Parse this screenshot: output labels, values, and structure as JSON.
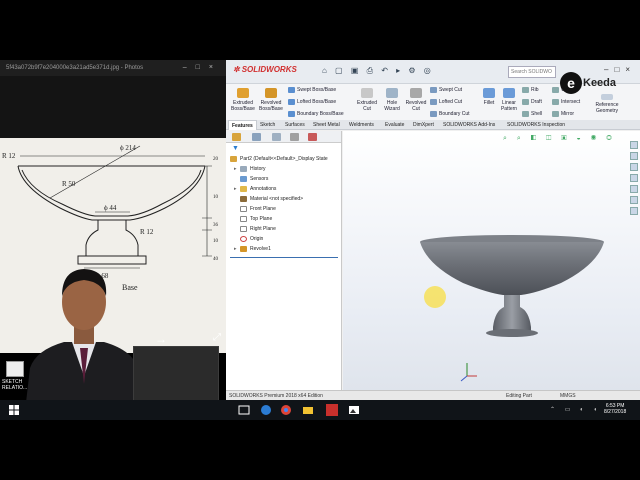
{
  "photos": {
    "title": "5f43a072b9f7e204000e3a21ad5e371d.jpg - Photos",
    "drawing_labels": {
      "dia_top": "ϕ 214",
      "r_left": "R 12",
      "r50": "R 50",
      "dia_stem": "ϕ 44",
      "r12_stem": "R 12",
      "base_dia": "ϕ 68",
      "base_label": "Base",
      "v_label_1": "20",
      "v_label_2": "10",
      "v_label_3": "36",
      "v_label_4": "10",
      "v_label_5": "40"
    }
  },
  "solidworks": {
    "brand": "SOLIDWORKS",
    "search_placeholder": "Search SOLIDWO",
    "ribbon": {
      "extruded_boss": "Extruded Boss/Base",
      "revolved_boss": "Revolved Boss/Base",
      "swept_boss": "Swept Boss/Base",
      "lofted_boss": "Lofted Boss/Base",
      "boundary_boss": "Boundary Boss/Base",
      "extruded_cut": "Extruded Cut",
      "hole_wizard": "Hole Wizard",
      "revolved_cut": "Revolved Cut",
      "swept_cut": "Swept Cut",
      "lofted_cut": "Lofted Cut",
      "boundary_cut": "Boundary Cut",
      "fillet": "Fillet",
      "linear_pattern": "Linear Pattern",
      "rib": "Rib",
      "draft": "Draft",
      "shell": "Shell",
      "wrap": "Wrap",
      "intersect": "Intersect",
      "mirror": "Mirror",
      "reference_geometry": "Reference Geometry"
    },
    "tabs": [
      "Features",
      "Sketch",
      "Surfaces",
      "Sheet Metal",
      "Weldments",
      "Evaluate",
      "DimXpert",
      "SOLIDWORKS Add-Ins",
      "SOLIDWORKS Inspection"
    ],
    "tree": {
      "root": "Part2 (Default<<Default>_Display State",
      "items": [
        "History",
        "Sensors",
        "Annotations",
        "Material <not specified>",
        "Front Plane",
        "Top Plane",
        "Right Plane",
        "Origin",
        "Revolve1"
      ]
    },
    "status": {
      "edition": "SOLIDWORKS Premium 2018 x64 Edition",
      "mode": "Editing Part",
      "units": "MMGS"
    }
  },
  "brand_logo": {
    "letter": "e",
    "text": "Keeda"
  },
  "desktop_icon": {
    "label_1": "SKETCH",
    "label_2": "RELATIO..."
  },
  "taskbar": {
    "time": "6:53 PM",
    "date": "8/27/2018"
  },
  "colors": {
    "sw_red": "#d12f2f",
    "accent_blue": "#2a7dd0",
    "taskbar": "#101418",
    "cursor_highlight": "#fadc28"
  }
}
